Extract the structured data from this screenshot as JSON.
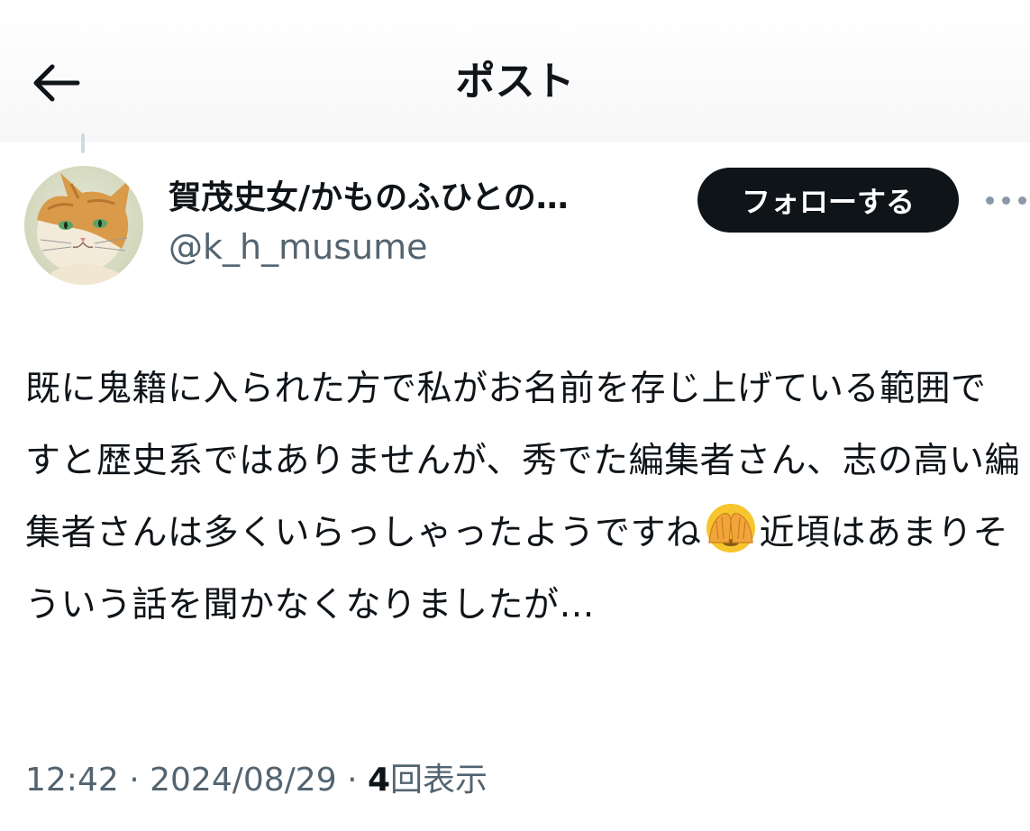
{
  "header": {
    "title": "ポスト",
    "back_icon": "arrow-left-icon"
  },
  "author": {
    "display_name": "賀茂史女/かものふひとの…",
    "handle": "@k_h_musume",
    "avatar": "cat-avatar"
  },
  "actions": {
    "follow_label": "フォローする",
    "more_icon": "more-dots-icon"
  },
  "post": {
    "text_before_emoji": "既に鬼籍に入られた方で私がお名前を存じ上げている範囲ですと歴史系ではありませんが、秀でた編集者さん、志の高い編集者さんは多くいらっしゃったようですね",
    "emoji": "face-with-hands-over-eyes",
    "text_after_emoji": "近頃はあまりそういう話を聞かなくなりましたが…"
  },
  "meta": {
    "time": "12:42",
    "sep1": "·",
    "date": "2024/08/29",
    "sep2": "·",
    "views_count": "4",
    "views_label": "回表示"
  },
  "colors": {
    "text_primary": "#0f1419",
    "text_secondary": "#536471",
    "follow_bg": "#0f1419"
  }
}
